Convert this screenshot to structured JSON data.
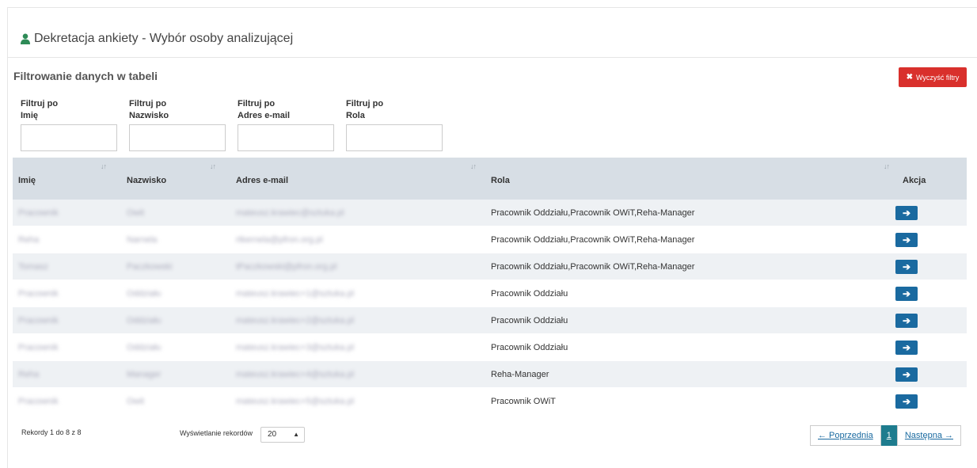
{
  "header": {
    "title": "Dekretacja ankiety - Wybór osoby analizującej",
    "icon": "user-icon",
    "icon_color": "#2e8b57"
  },
  "filters": {
    "section_title": "Filtrowanie danych w tabeli",
    "clear_label": "Wyczyść filtry",
    "clear_color": "#d9302c",
    "items": [
      {
        "line1": "Filtruj po",
        "line2": "Imię",
        "value": ""
      },
      {
        "line1": "Filtruj po",
        "line2": "Nazwisko",
        "value": ""
      },
      {
        "line1": "Filtruj po",
        "line2": "Adres e-mail",
        "value": ""
      },
      {
        "line1": "Filtruj po",
        "line2": "Rola",
        "value": ""
      }
    ]
  },
  "table": {
    "columns": [
      "Imię",
      "Nazwisko",
      "Adres e-mail",
      "Rola",
      "Akcja"
    ],
    "rows": [
      {
        "imie": "Pracownik",
        "nazwisko": "Owit",
        "email": "mateusz.krawiec@sztuka.pl",
        "rola": "Pracownik Oddziału,Pracownik OWiT,Reha-Manager"
      },
      {
        "imie": "Reha",
        "nazwisko": "Narnela",
        "email": "rtkernela@pfron.org.pl",
        "rola": "Pracownik Oddziału,Pracownik OWiT,Reha-Manager"
      },
      {
        "imie": "Tomasz",
        "nazwisko": "Paczkowski",
        "email": "tPaczkowski@pfron.org.pl",
        "rola": "Pracownik Oddziału,Pracownik OWiT,Reha-Manager"
      },
      {
        "imie": "Pracownik",
        "nazwisko": "Oddziału",
        "email": "mateusz.krawiec+1@sztuka.pl",
        "rola": "Pracownik Oddziału"
      },
      {
        "imie": "Pracownik",
        "nazwisko": "Oddziału",
        "email": "mateusz.krawiec+2@sztuka.pl",
        "rola": "Pracownik Oddziału"
      },
      {
        "imie": "Pracownik",
        "nazwisko": "Oddziału",
        "email": "mateusz.krawiec+3@sztuka.pl",
        "rola": "Pracownik Oddziału"
      },
      {
        "imie": "Reha",
        "nazwisko": "Manager",
        "email": "mateusz.krawiec+4@sztuka.pl",
        "rola": "Reha-Manager"
      },
      {
        "imie": "Pracownik",
        "nazwisko": "Owit",
        "email": "mateusz.krawiec+5@sztuka.pl",
        "rola": "Pracownik OWiT"
      }
    ],
    "header_bg": "#d7dee5",
    "action_color": "#1a6aa0"
  },
  "footer": {
    "records_info": "Rekordy 1 do 8 z 8",
    "pagesize_label": "Wyświetlanie rekordów",
    "pagesize_value": "20",
    "prev_label": "← Poprzednia",
    "current_page": "1",
    "next_label": "Następna →"
  }
}
